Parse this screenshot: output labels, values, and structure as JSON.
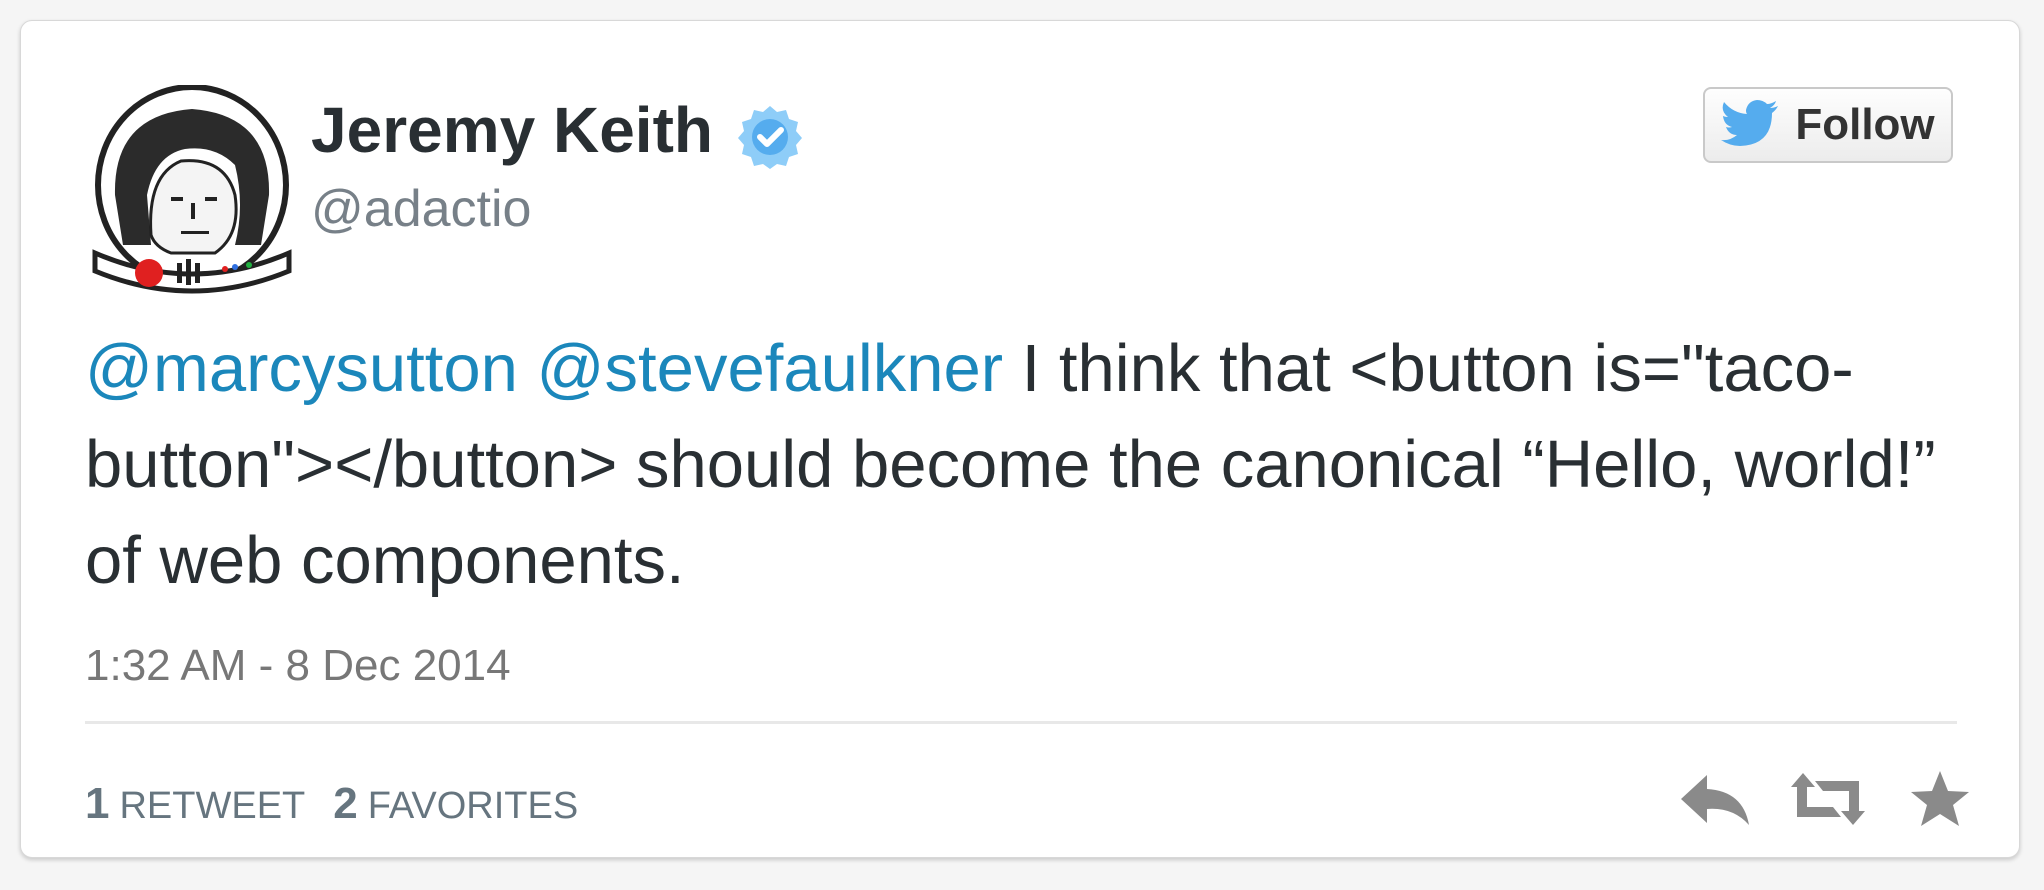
{
  "user": {
    "name": "Jeremy Keith",
    "handle": "@adactio"
  },
  "follow_button": {
    "label": "Follow"
  },
  "tweet": {
    "mention_1": "@marcysutton",
    "mention_2": "@stevefaulkner",
    "text": " I think that <button is=\"taco-button\"></button> should become the canonical “Hello, world!” of web components.",
    "timestamp": "1:32 AM - 8 Dec 2014"
  },
  "stats": {
    "retweets_count": "1",
    "retweets_label": "RETWEET",
    "favorites_count": "2",
    "favorites_label": "FAVORITES"
  },
  "icons": {
    "avatar": "astronaut-avatar",
    "verified": "verified-badge-icon",
    "bird": "twitter-bird-icon",
    "reply": "reply-icon",
    "retweet": "retweet-icon",
    "favorite": "star-icon"
  },
  "colors": {
    "mention": "#1b87bb",
    "verified": "#55acee",
    "bird": "#55acee",
    "action_icons": "#8a8a8a"
  }
}
